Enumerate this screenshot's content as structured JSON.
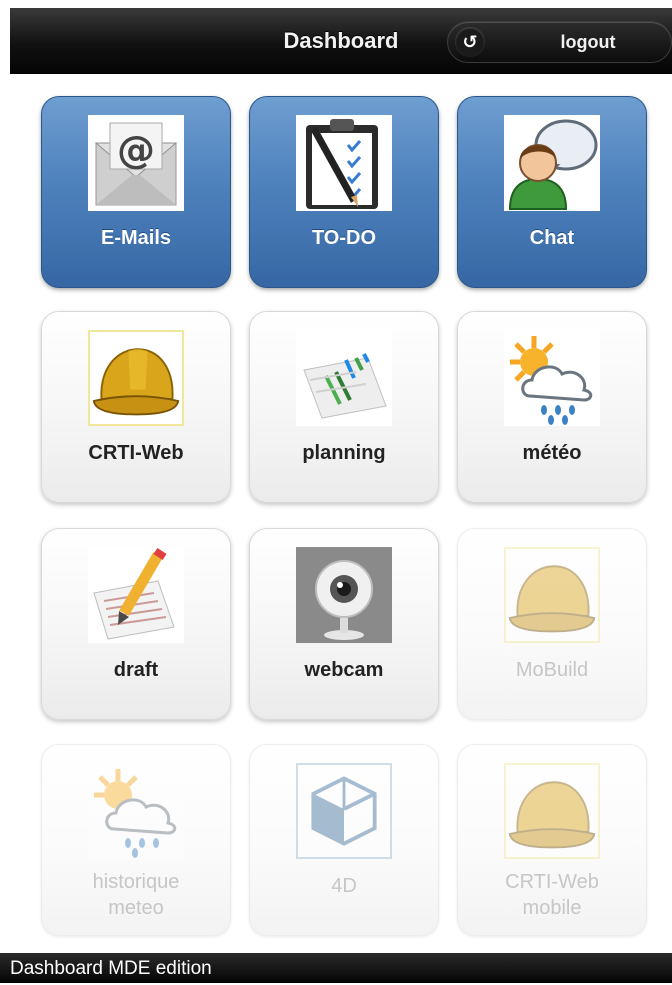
{
  "header": {
    "title": "Dashboard",
    "logout_label": "logout",
    "logout_icon": "refresh-icon"
  },
  "tiles": [
    {
      "label": "E-Mails",
      "icon": "envelope-at-icon",
      "style": "blue",
      "enabled": true
    },
    {
      "label": "TO-DO",
      "icon": "clipboard-checklist-icon",
      "style": "blue",
      "enabled": true
    },
    {
      "label": "Chat",
      "icon": "person-speech-bubble-icon",
      "style": "blue",
      "enabled": true
    },
    {
      "label": "CRTI-Web",
      "icon": "hard-hat-icon",
      "style": "light",
      "enabled": true
    },
    {
      "label": "planning",
      "icon": "gantt-chart-icon",
      "style": "light",
      "enabled": true
    },
    {
      "label": "météo",
      "icon": "sun-rain-cloud-icon",
      "style": "light",
      "enabled": true
    },
    {
      "label": "draft",
      "icon": "pencil-paper-icon",
      "style": "light",
      "enabled": true
    },
    {
      "label": "webcam",
      "icon": "webcam-icon",
      "style": "light",
      "enabled": true
    },
    {
      "label": "MoBuild",
      "icon": "hard-hat-icon",
      "style": "light",
      "enabled": false
    },
    {
      "label_line1": "historique",
      "label_line2": "meteo",
      "icon": "sun-rain-cloud-icon",
      "style": "light",
      "enabled": false
    },
    {
      "label": "4D",
      "icon": "cube-icon",
      "style": "light",
      "enabled": false
    },
    {
      "label_line1": "CRTI-Web",
      "label_line2": "mobile",
      "icon": "hard-hat-icon",
      "style": "light",
      "enabled": false
    }
  ],
  "footer": {
    "text": "Dashboard MDE edition"
  },
  "colors": {
    "tile_blue": "#4e82bd",
    "header_bg": "#111111"
  }
}
